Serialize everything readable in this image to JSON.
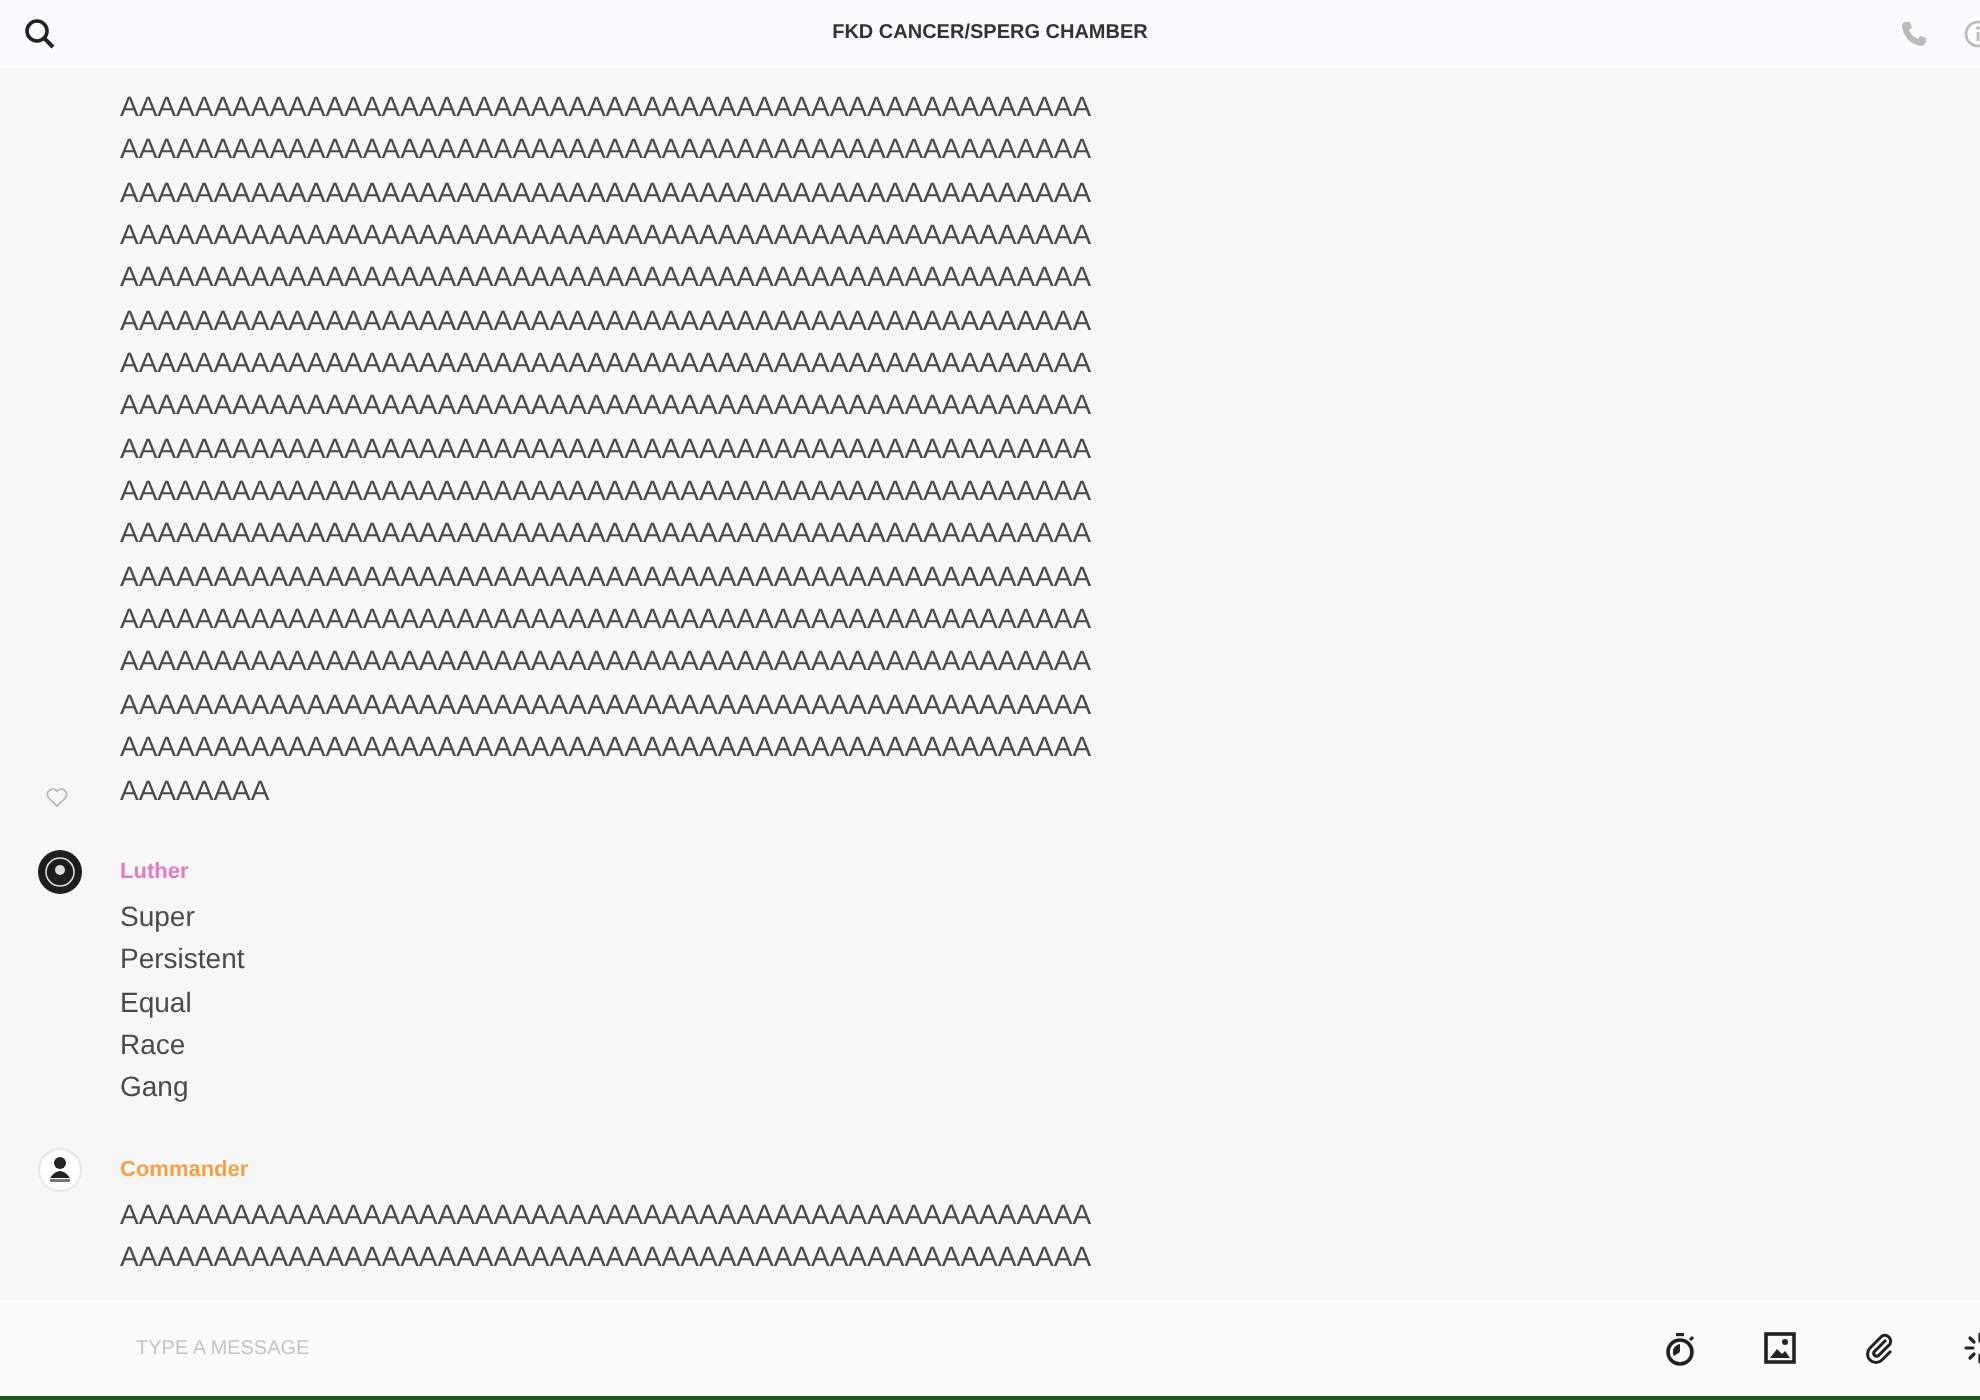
{
  "header": {
    "title": "FKD CANCER/SPERG CHAMBER"
  },
  "messages": [
    {
      "like_button": {
        "liked": false
      },
      "lines": [
        "AAAAAAAAAAAAAAAAAAAAAAAAAAAAAAAAAAAAAAAAAAAAAAAAAAAA",
        "AAAAAAAAAAAAAAAAAAAAAAAAAAAAAAAAAAAAAAAAAAAAAAAAAAAA",
        "AAAAAAAAAAAAAAAAAAAAAAAAAAAAAAAAAAAAAAAAAAAAAAAAAAAA",
        "AAAAAAAAAAAAAAAAAAAAAAAAAAAAAAAAAAAAAAAAAAAAAAAAAAAA",
        "AAAAAAAAAAAAAAAAAAAAAAAAAAAAAAAAAAAAAAAAAAAAAAAAAAAA",
        "AAAAAAAAAAAAAAAAAAAAAAAAAAAAAAAAAAAAAAAAAAAAAAAAAAAA",
        "AAAAAAAAAAAAAAAAAAAAAAAAAAAAAAAAAAAAAAAAAAAAAAAAAAAA",
        "AAAAAAAAAAAAAAAAAAAAAAAAAAAAAAAAAAAAAAAAAAAAAAAAAAAA",
        "AAAAAAAAAAAAAAAAAAAAAAAAAAAAAAAAAAAAAAAAAAAAAAAAAAAA",
        "AAAAAAAAAAAAAAAAAAAAAAAAAAAAAAAAAAAAAAAAAAAAAAAAAAAA",
        "AAAAAAAAAAAAAAAAAAAAAAAAAAAAAAAAAAAAAAAAAAAAAAAAAAAA",
        "AAAAAAAAAAAAAAAAAAAAAAAAAAAAAAAAAAAAAAAAAAAAAAAAAAAA",
        "AAAAAAAAAAAAAAAAAAAAAAAAAAAAAAAAAAAAAAAAAAAAAAAAAAAA",
        "AAAAAAAAAAAAAAAAAAAAAAAAAAAAAAAAAAAAAAAAAAAAAAAAAAAA",
        "AAAAAAAAAAAAAAAAAAAAAAAAAAAAAAAAAAAAAAAAAAAAAAAAAAAA",
        "AAAAAAAAAAAAAAAAAAAAAAAAAAAAAAAAAAAAAAAAAAAAAAAAAAAA",
        "AAAAAAAA"
      ]
    },
    {
      "author": {
        "name": "Luther",
        "color": "#e57bc5"
      },
      "lines": [
        "Super",
        "Persistent",
        "Equal",
        "Race",
        "Gang"
      ]
    },
    {
      "author": {
        "name": "Commander",
        "color": "#f5a142"
      },
      "lines": [
        "AAAAAAAAAAAAAAAAAAAAAAAAAAAAAAAAAAAAAAAAAAAAAAAAAAAA",
        "AAAAAAAAAAAAAAAAAAAAAAAAAAAAAAAAAAAAAAAAAAAAAAAAAAAA"
      ]
    }
  ],
  "composer": {
    "placeholder": "TYPE A MESSAGE"
  }
}
